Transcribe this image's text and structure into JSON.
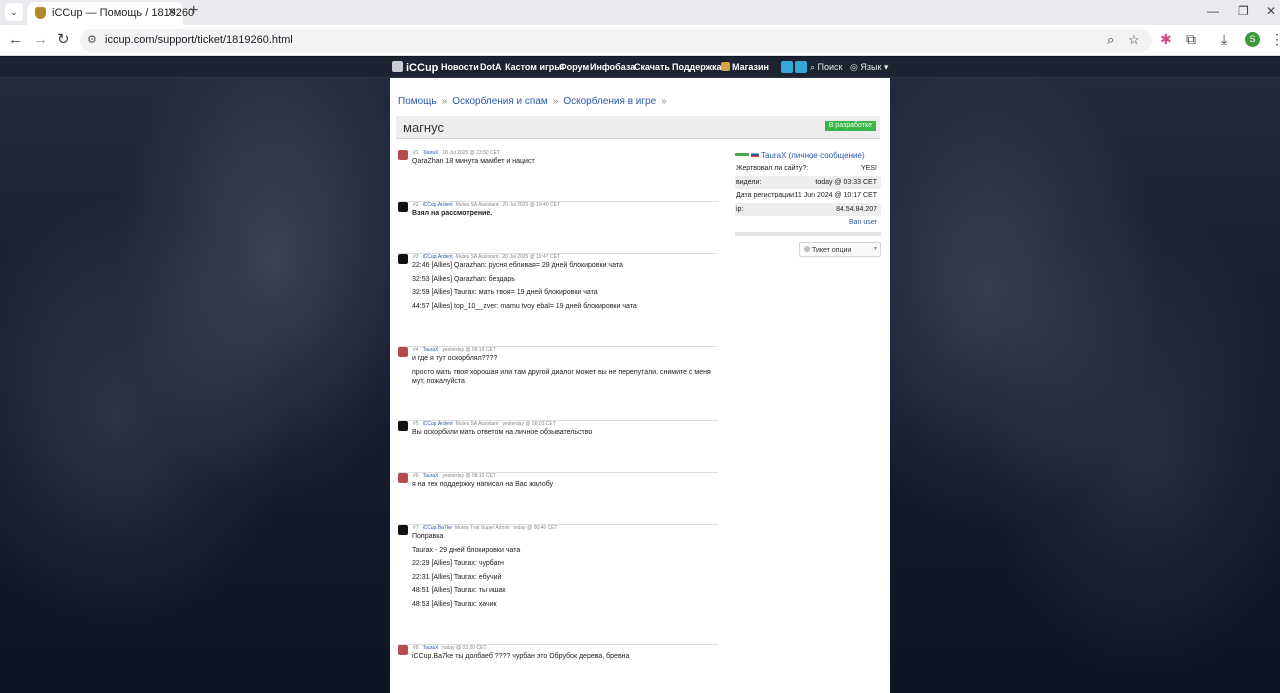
{
  "browser": {
    "tab_title": "iCCup — Помощь / 1819260",
    "url": "iccup.com/support/ticket/1819260.html",
    "profile_initial": "S"
  },
  "site_nav": {
    "logo": "iCCup",
    "items": [
      "Новости",
      "DotA",
      "Кастом игры",
      "Форум",
      "Инфобаза",
      "Скачать",
      "Поддержка"
    ],
    "shop": "Магазин",
    "search": "Поиск",
    "language": "Язык"
  },
  "breadcrumb": [
    "Помощь",
    "Оскорбления и спам",
    "Оскорбления в игре"
  ],
  "ticket": {
    "title": "магнус",
    "status": "В разработке"
  },
  "posts": [
    {
      "num": "#1",
      "author": "TauraX",
      "role": "",
      "date": "18 Jul 2025 @ 23:50 CET",
      "avatar": "user",
      "lines": [
        {
          "text": "QaraZhan 18 минута мамбет и нацист",
          "bold": false
        }
      ]
    },
    {
      "num": "#2",
      "author": "iCCup.Ardent",
      "role": "Mutes SA Assistant",
      "date": "20 Jul 2025 @ 19:40 CET",
      "avatar": "admin",
      "lines": [
        {
          "text": "Взял на рассмотрение.",
          "bold": true
        }
      ]
    },
    {
      "num": "#3",
      "author": "iCCup.Ardent",
      "role": "Mutes SA Assistant",
      "date": "20 Jul 2025 @ 19:47 CET",
      "avatar": "admin",
      "lines": [
        {
          "text": "22:46 [Allies] Qarazhan: русня ебливая= 29 дней блокировки чата",
          "bold": false
        },
        {
          "text": "32:53 [Allies] Qarazhan: бездарь",
          "bold": false
        },
        {
          "text": "32:59 [Allies] Taurax: мать твоя= 19 дней блокировки чата",
          "bold": false
        },
        {
          "text": "44:57 [Allies] top_10__zver: mamu tvoy ebal= 19 дней блокировки чата",
          "bold": false
        }
      ]
    },
    {
      "num": "#4",
      "author": "TauraX",
      "role": "",
      "date": "yesterday @ 06:18 CET",
      "avatar": "user",
      "lines": [
        {
          "text": "и где я тут оскорблял????",
          "bold": false
        },
        {
          "text": "просто мать твоя хорошая или там другой диалог может вы не перепутали, снимите с меня мут, пожалуйста",
          "bold": false
        }
      ]
    },
    {
      "num": "#5",
      "author": "iCCup.Ardent",
      "role": "Mutes SA Assistant",
      "date": "yesterday @ 08:03 CET",
      "avatar": "admin",
      "lines": [
        {
          "text": "Вы оскорбили мать ответом на личное обзывательство",
          "bold": false
        }
      ]
    },
    {
      "num": "#6",
      "author": "TauraX",
      "role": "",
      "date": "yesterday @ 08:10 CET",
      "avatar": "user",
      "lines": [
        {
          "text": "я на тех поддержку написал на Вас жалобу",
          "bold": false
        }
      ]
    },
    {
      "num": "#7",
      "author": "iCCup.Ba7ke",
      "role": "Mutes Trial Super Admin",
      "date": "today @ 00:46 CET",
      "avatar": "admin",
      "lines": [
        {
          "text": "Поправка",
          "bold": false
        },
        {
          "text": "Taurax - 29 дней блокировки чата",
          "bold": false
        },
        {
          "text": "22:29 [Allies] Taurax: чурбагн",
          "bold": false
        },
        {
          "text": "22:31 [Allies] Taurax: ебучий",
          "bold": false
        },
        {
          "text": "48:51 [Allies] Taurax: ты ишак",
          "bold": false
        },
        {
          "text": "48:53 [Allies] Taurax: хачик",
          "bold": false
        }
      ]
    },
    {
      "num": "#8",
      "author": "TauraX",
      "role": "",
      "date": "today @ 03:20 CET",
      "avatar": "user",
      "lines": [
        {
          "text": "iCCup.Ba7ke ты долбаеб ???? чурбан это Обрубок дерева, бревна",
          "bold": false
        }
      ]
    }
  ],
  "sidebar": {
    "user": "TauraX",
    "pm": "(личное сообщение)",
    "rows": [
      {
        "label": "Жертвовал ли сайту?:",
        "value": "YES!"
      },
      {
        "label": "видели:",
        "value": "today @ 03:33 CET"
      },
      {
        "label": "Дата регистрации:",
        "value": "11 Jun 2024 @ 10:17 CET"
      },
      {
        "label": "ip:",
        "value": "84.54.84.207"
      }
    ],
    "ban": "Ban user",
    "options": "Тикет опции"
  }
}
